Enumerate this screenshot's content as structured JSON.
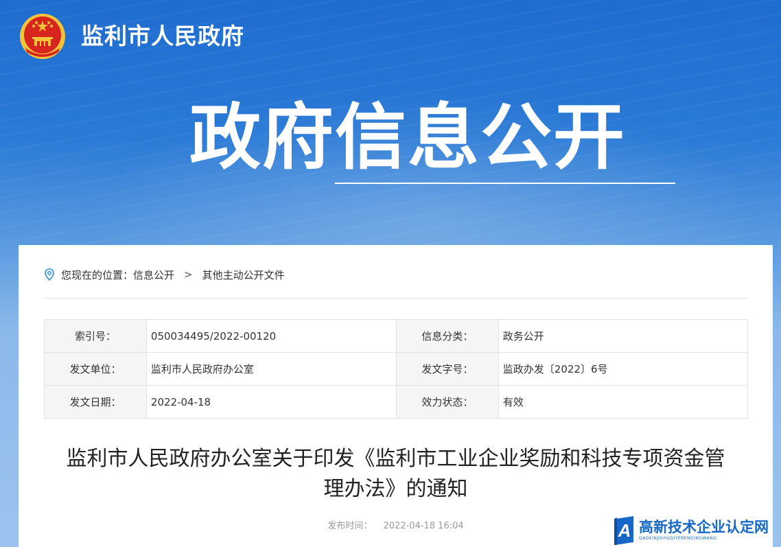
{
  "header": {
    "site_title": "监利市人民政府",
    "hero_title": "政府信息公开"
  },
  "breadcrumb": {
    "prefix": "您现在的位置：",
    "items": [
      "信息公开",
      "其他主动公开文件"
    ],
    "separator": ">"
  },
  "meta": {
    "rows": [
      {
        "k1": "索引号：",
        "v1": "050034495/2022-00120",
        "k2": "信息分类：",
        "v2": "政务公开"
      },
      {
        "k1": "发文单位：",
        "v1": "监利市人民政府办公室",
        "k2": "发文字号：",
        "v2": "监政办发〔2022〕6号"
      },
      {
        "k1": "发文日期：",
        "v1": "2022-04-18",
        "k2": "效力状态：",
        "v2": "有效"
      }
    ]
  },
  "document": {
    "title_line1": "监利市人民政府办公室关于印发《监利市工业企业奖励和科技专项资金管",
    "title_line2": "理办法》的通知",
    "publish_label": "发布时间：",
    "publish_time": "2022-04-18 16:04"
  },
  "watermark": {
    "main": "高新技术企业认定网",
    "sub": "GAOXINJISHUQIYERENDINGWANG"
  },
  "icons": {
    "emblem": "national-emblem-icon",
    "location": "location-pin-icon",
    "watermark_logo": "a-logo-icon"
  },
  "colors": {
    "banner_top": "#1f6ccf",
    "banner_bottom": "#9cc3ee",
    "accent": "#1667c8",
    "emblem_red": "#d7261e",
    "emblem_gold": "#f3c33a"
  }
}
